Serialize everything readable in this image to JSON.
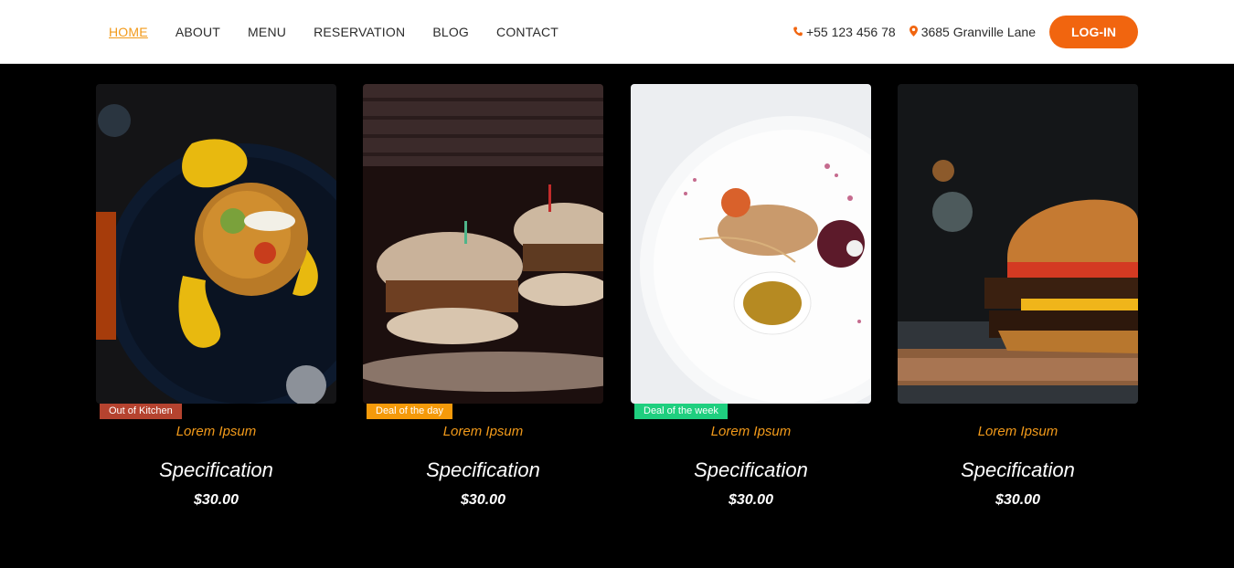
{
  "nav": {
    "items": [
      {
        "label": "HOME",
        "active": true
      },
      {
        "label": "ABOUT",
        "active": false
      },
      {
        "label": "MENU",
        "active": false
      },
      {
        "label": "RESERVATION",
        "active": false
      },
      {
        "label": "BLOG",
        "active": false
      },
      {
        "label": "CONTACT",
        "active": false
      }
    ]
  },
  "contact": {
    "phone": "+55 123 456 78",
    "address": "3685 Granville Lane",
    "login_label": "LOG-IN"
  },
  "colors": {
    "accent": "#f1650f",
    "nav_active": "#f29a1a",
    "badge_out_of_kitchen": "#b5432f",
    "badge_deal_day": "#f59a0a",
    "badge_deal_week": "#1fcf7f"
  },
  "cards": [
    {
      "badge": "Out of Kitchen",
      "badge_color": "#b5432f",
      "subtitle": "Lorem Ipsum",
      "title": "Specification",
      "price": "$30.00",
      "image": "plate-with-sauce-photo"
    },
    {
      "badge": "Deal of the day",
      "badge_color": "#f59a0a",
      "subtitle": "Lorem Ipsum",
      "title": "Specification",
      "price": "$30.00",
      "image": "two-burgers-photo"
    },
    {
      "badge": "Deal of the week",
      "badge_color": "#1fcf7f",
      "subtitle": "Lorem Ipsum",
      "title": "Specification",
      "price": "$30.00",
      "image": "fish-dish-photo"
    },
    {
      "badge": "",
      "badge_color": "",
      "subtitle": "Lorem Ipsum",
      "title": "Specification",
      "price": "$30.00",
      "image": "burger-photo"
    }
  ]
}
